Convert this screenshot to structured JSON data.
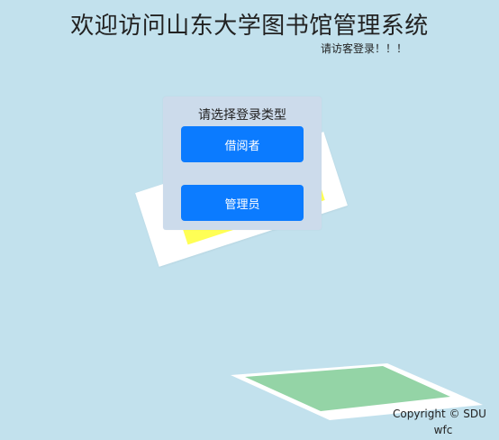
{
  "header": {
    "title": "欢迎访问山东大学图书馆管理系统",
    "subtitle": "请访客登录！！！"
  },
  "login": {
    "heading": "请选择登录类型",
    "reader_label": "借阅者",
    "admin_label": "管理员"
  },
  "footer": {
    "copyright": "Copyright ©  SDU",
    "author": "wfc"
  },
  "colors": {
    "background": "#c2e1ed",
    "card": "#ccdbeb",
    "button": "#0b7bff",
    "paper_yellow": "#ffff55",
    "paper_green": "#94d4a6"
  }
}
